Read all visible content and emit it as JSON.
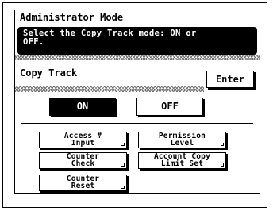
{
  "mode_title": "Administrator Mode",
  "message": {
    "line1": "Select the Copy Track mode: ON or",
    "line2": "OFF."
  },
  "section": {
    "title": "Copy Track",
    "enter_label": "Enter"
  },
  "toggle": {
    "on_label": "ON",
    "off_label": "OFF",
    "selected": "ON"
  },
  "function_buttons": [
    {
      "line1": "Access #",
      "line2": "Input"
    },
    {
      "line1": "Permission",
      "line2": "Level"
    },
    {
      "line1": "Counter",
      "line2": "Check"
    },
    {
      "line1": "Account Copy",
      "line2": "Limit Set"
    },
    {
      "line1": "Counter",
      "line2": "Reset"
    }
  ]
}
